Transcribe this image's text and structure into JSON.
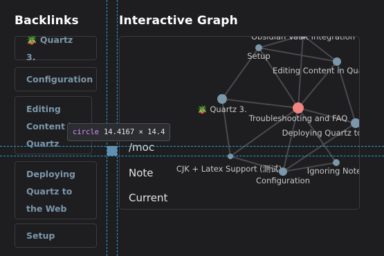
{
  "sidebar": {
    "title": "Backlinks",
    "items": [
      {
        "label": "🪴 Quartz 3."
      },
      {
        "label": "Configuration"
      },
      {
        "label": "Editing Content in Quartz"
      },
      {
        "label": "Deploying Quartz to the Web"
      },
      {
        "label": "Setup"
      }
    ]
  },
  "graph": {
    "title": "Interactive Graph",
    "nodes": [
      {
        "label": "Obsidian Vault Integration",
        "current": false
      },
      {
        "label": "Setup",
        "current": false
      },
      {
        "label": "Editing Content in Quartz",
        "current": false
      },
      {
        "label": "🪴 Quartz 3.",
        "current": false
      },
      {
        "label": "Troubleshooting and FAQ",
        "current": true
      },
      {
        "label": "Deploying Quartz to the Web",
        "current": false
      },
      {
        "label": "CJK + Latex Support (测试)",
        "current": false
      },
      {
        "label": "Configuration",
        "current": false
      },
      {
        "label": "Ignoring Notes",
        "current": false
      }
    ],
    "colors": {
      "node": "#7b97aa",
      "current_node": "#f28482",
      "link": "#4a4a4f"
    }
  },
  "legend": {
    "items": [
      {
        "label": "/moc"
      },
      {
        "label": "Note"
      },
      {
        "label": "Current"
      }
    ]
  },
  "inspector": {
    "tag": "circle",
    "size": "14.4167 × 14.4",
    "guide_color": "#2aa3d6"
  }
}
